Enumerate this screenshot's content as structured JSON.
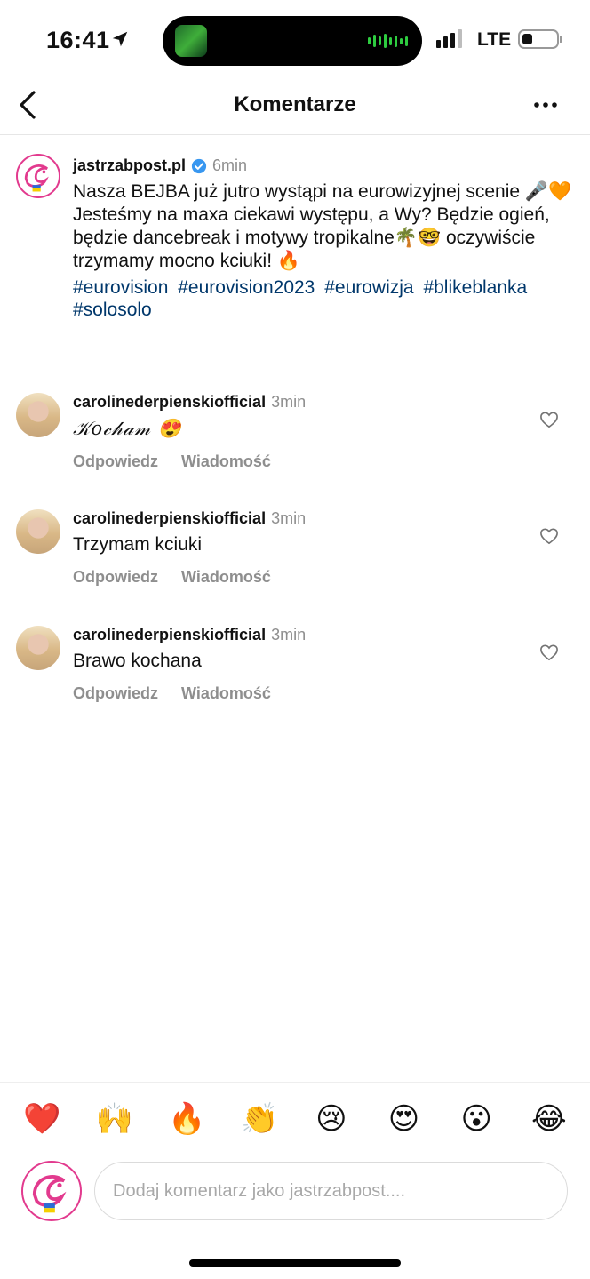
{
  "status_bar": {
    "time": "16:41",
    "network": "LTE",
    "signal_bars": 3,
    "battery_level": 0.3
  },
  "header": {
    "title": "Komentarze",
    "back_icon": "chevron-left-icon",
    "more_icon": "more-horizontal-icon"
  },
  "post": {
    "username": "jastrzabpost.pl",
    "time": "6min",
    "caption_line1": "Nasza BEJBA już jutro wystąpi na eurowizyjnej scenie 🎤🧡",
    "caption_line2": "Jesteśmy na maxa ciekawi występu, a Wy? Będzie ogień, będzie dancebreak i motywy tropikalne🌴🤓 oczywiście trzymamy mocno kciuki! 🔥",
    "hashtags": [
      "#eurovision",
      "#eurovision2023",
      "#eurowizja",
      "#blikeblanka",
      "#solosolo"
    ]
  },
  "comments": [
    {
      "username": "carolinederpienskiofficial",
      "time": "3min",
      "text": "𝒦𝑜𝒸𝒽𝒶𝓂 😍",
      "reply": "Odpowiedz",
      "message": "Wiadomość"
    },
    {
      "username": "carolinederpienskiofficial",
      "time": "3min",
      "text": "Trzymam kciuki",
      "reply": "Odpowiedz",
      "message": "Wiadomość"
    },
    {
      "username": "carolinederpienskiofficial",
      "time": "3min",
      "text": "Brawo kochana",
      "reply": "Odpowiedz",
      "message": "Wiadomość"
    }
  ],
  "reactions": [
    "❤️",
    "🙌",
    "🔥",
    "👏",
    "😢",
    "😍",
    "😮",
    "😂"
  ],
  "input": {
    "placeholder": "Dodaj komentarz jako jastrzabpost...."
  },
  "colors": {
    "brand_pink": "#e23a8e",
    "hashtag": "#00376b",
    "muted": "#8e8e8e",
    "verified": "#3897f0"
  }
}
